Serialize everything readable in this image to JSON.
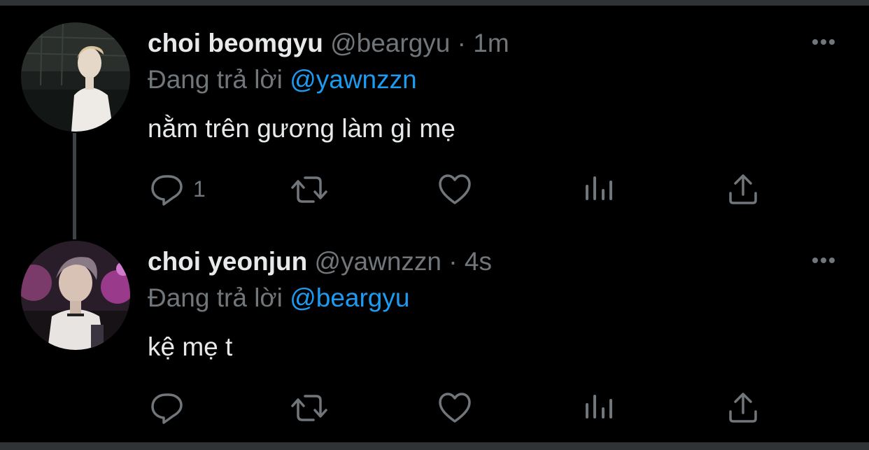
{
  "colors": {
    "background": "#000000",
    "text": "#e7e9ea",
    "secondary": "#71767b",
    "link": "#1d9bf0",
    "divider": "#2f3336"
  },
  "tweets": [
    {
      "name": "choi beomgyu",
      "handle": "@beargyu",
      "separator": "·",
      "time": "1m",
      "reply_prefix": "Đang trả lời",
      "reply_to": "@yawnzzn",
      "text": "nằm trên gương làm gì mẹ",
      "reply_count": "1",
      "avatar_icon": "avatar-photo"
    },
    {
      "name": "choi yeonjun",
      "handle": "@yawnzzn",
      "separator": "·",
      "time": "4s",
      "reply_prefix": "Đang trả lời",
      "reply_to": "@beargyu",
      "text": "kệ mẹ t",
      "reply_count": "",
      "avatar_icon": "avatar-photo"
    }
  ],
  "icons": {
    "reply": "reply-icon",
    "retweet": "retweet-icon",
    "like": "like-icon",
    "views": "views-icon",
    "share": "share-icon",
    "more": "more-icon"
  }
}
